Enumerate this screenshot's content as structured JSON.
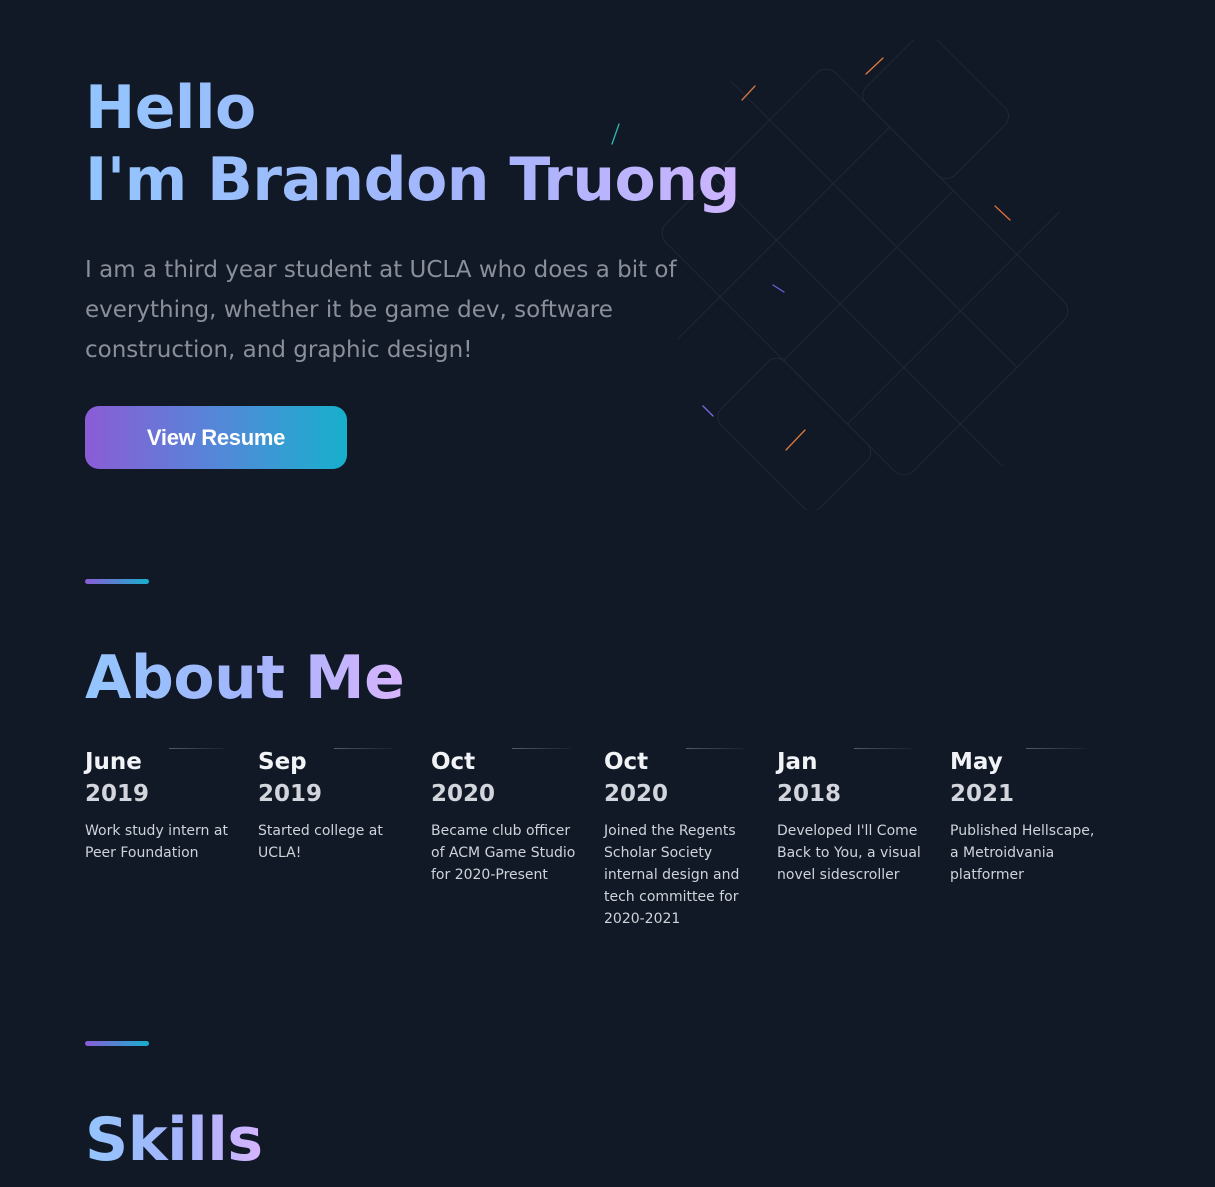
{
  "hero": {
    "greeting": "Hello",
    "name_line": "I'm Brandon Truong",
    "intro": "I am a third year student at UCLA who does a bit of everything, whether it be game dev, software construction, and graphic design!",
    "resume_button": "View Resume"
  },
  "about": {
    "title": "About Me",
    "timeline": [
      {
        "month": "June",
        "year": "2019",
        "description": "Work study intern at Peer Foundation"
      },
      {
        "month": "Sep",
        "year": "2019",
        "description": "Started college at UCLA!"
      },
      {
        "month": "Oct",
        "year": "2020",
        "description": "Became club officer of ACM Game Studio for 2020-Present"
      },
      {
        "month": "Oct",
        "year": "2020",
        "description": "Joined the Regents Scholar Society internal design and tech committee for 2020-2021"
      },
      {
        "month": "Jan",
        "year": "2018",
        "description": "Developed I'll Come Back to You, a visual novel sidescroller"
      },
      {
        "month": "May",
        "year": "2021",
        "description": "Published Hellscape, a Metroidvania platformer"
      }
    ]
  },
  "skills": {
    "title": "Skills"
  },
  "colors": {
    "background": "#111826",
    "heading_gradient_start": "#93c5fd",
    "heading_gradient_end": "#d8b4fe",
    "button_gradient_start": "#8b5cd6",
    "button_gradient_end": "#17b0cc",
    "body_text": "#8a8f99"
  }
}
